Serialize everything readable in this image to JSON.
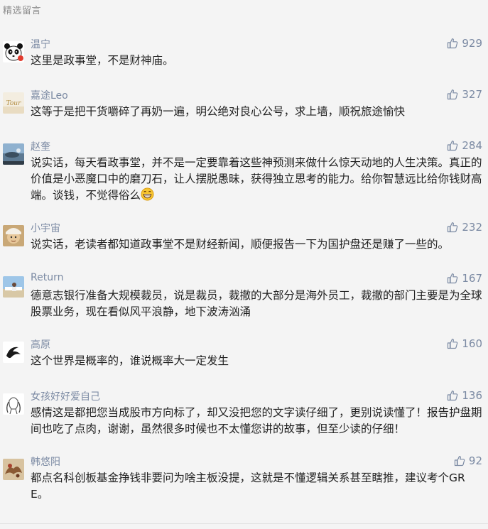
{
  "section_title": "精选留言",
  "comments": [
    {
      "nickname": "温宁",
      "likes": "929",
      "text": "这里是政事堂，不是财神庙。"
    },
    {
      "nickname": "嘉途Leo",
      "likes": "327",
      "text": "这等于是把干货嚼碎了再奶一遍，明公绝对良心公号，求上墙，顺祝旅途愉快"
    },
    {
      "nickname": "赵奎",
      "likes": "284",
      "text": "说实话，每天看政事堂，并不是一定要靠着这些神预测来做什么惊天动地的人生决策。真正的价值是小恶魔口中的磨刀石，让人摆脱愚昧，获得独立思考的能力。给你智慧远比给你钱财高端。谈钱，不觉得俗么"
    },
    {
      "nickname": "小宇宙",
      "likes": "232",
      "text": "说实话，老读者都知道政事堂不是财经新闻，顺便报告一下为国护盘还是赚了一些的。"
    },
    {
      "nickname": "Return",
      "likes": "167",
      "text": "德意志银行准备大规模裁员，说是裁员，裁撤的大部分是海外员工，裁撤的部门主要是为全球股票业务，现在看似风平浪静，地下波涛汹涌"
    },
    {
      "nickname": "高原",
      "likes": "160",
      "text": "这个世界是概率的，谁说概率大一定发生"
    },
    {
      "nickname": "女孩好好爱自己",
      "likes": "136",
      "text": "感情这是都把您当成股市方向标了，却又没把您的文字读仔细了，更别说读懂了！报告护盘期间也吃了点肉，谢谢，虽然很多时候也不太懂您讲的故事，但至少读的仔细！"
    },
    {
      "nickname": "韩悠阳",
      "likes": "92",
      "text": "都点名科创板基金挣钱非要问为啥主板没提，这就是不懂逻辑关系甚至瞎推，建议考个GRE。"
    }
  ],
  "icons": {
    "like": "thumbs-up-icon",
    "emoji": "grin-emoji-icon"
  },
  "colors": {
    "nickname": "#7b8aa3",
    "text": "#222222",
    "background": "#f4f4f4"
  }
}
